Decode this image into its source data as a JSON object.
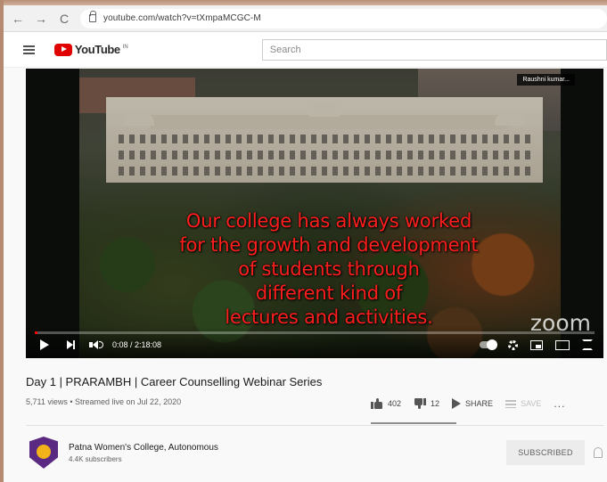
{
  "browser": {
    "url": "youtube.com/watch?v=tXmpaMCGC-M"
  },
  "header": {
    "logo_text": "YouTube",
    "logo_tm": "IN",
    "search_placeholder": "Search"
  },
  "video": {
    "caption_lines": [
      "Our college has always worked",
      "for the growth and development",
      "of students through",
      "different kind of",
      "lectures and activities."
    ],
    "speaker_tag": "Raushni kumar...",
    "watermark": "zoom",
    "time": "0:08 / 2:18:08",
    "progress_fraction": 0.001
  },
  "info": {
    "title": "Day 1 | PRARAMBH | Career Counselling Webinar Series",
    "meta": "5,711 views • Streamed live on Jul 22, 2020",
    "likes": "402",
    "dislikes": "12",
    "share_label": "SHARE",
    "save_label": "SAVE",
    "more_label": "..."
  },
  "channel": {
    "name": "Patna Women's College, Autonomous",
    "subscribers": "4.4K subscribers",
    "subscribe_label": "SUBSCRIBED"
  },
  "colors": {
    "caption": "#ff1e1e",
    "brand_red": "#e00000",
    "progress": "#ff0000"
  }
}
